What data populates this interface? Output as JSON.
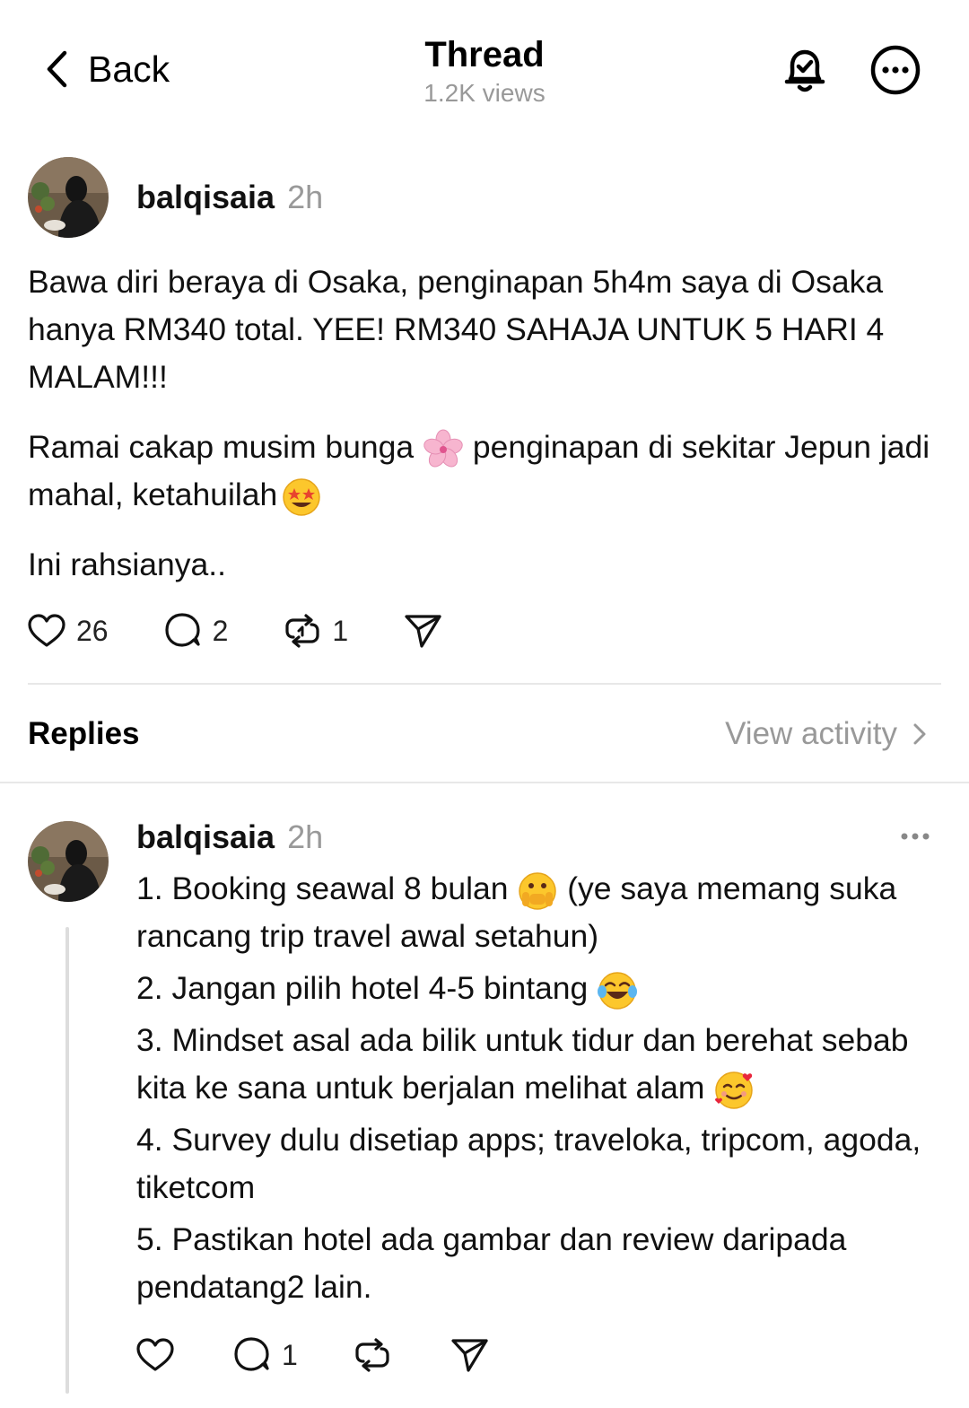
{
  "header": {
    "back_label": "Back",
    "title": "Thread",
    "views": "1.2K views",
    "icons": [
      "bell-check-icon",
      "more-circle-icon"
    ]
  },
  "post": {
    "username": "balqisaia",
    "time": "2h",
    "paragraphs": [
      "Bawa diri beraya di Osaka, penginapan 5h4m saya di Osaka hanya RM340 total. YEE! RM340 SAHAJA UNTUK 5 HARI 4 MALAM!!!",
      "Ramai cakap musim bunga",
      "penginapan di sekitar Jepun jadi mahal, ketahuilah",
      "Ini rahsianya.."
    ],
    "likes": "26",
    "comments": "2",
    "reposts": "1"
  },
  "replies_section": {
    "label": "Replies",
    "view_activity": "View activity"
  },
  "reply": {
    "username": "balqisaia",
    "time": "2h",
    "lines": {
      "l1a": "1. Booking seawal 8 bulan",
      "l1b": "(ye saya memang suka rancang trip travel awal setahun)",
      "l2": "2. Jangan pilih hotel 4-5 bintang",
      "l3": "3. Mindset asal ada bilik untuk tidur dan berehat sebab kita ke sana untuk berjalan melihat alam",
      "l4": "4. Survey dulu disetiap apps; traveloka, tripcom, agoda, tiketcom",
      "l5": "5. Pastikan hotel ada gambar dan review daripada pendatang2 lain."
    },
    "comments": "1"
  },
  "colors": {
    "text": "#111111",
    "muted": "#999999",
    "divider": "#e8e8e8"
  }
}
